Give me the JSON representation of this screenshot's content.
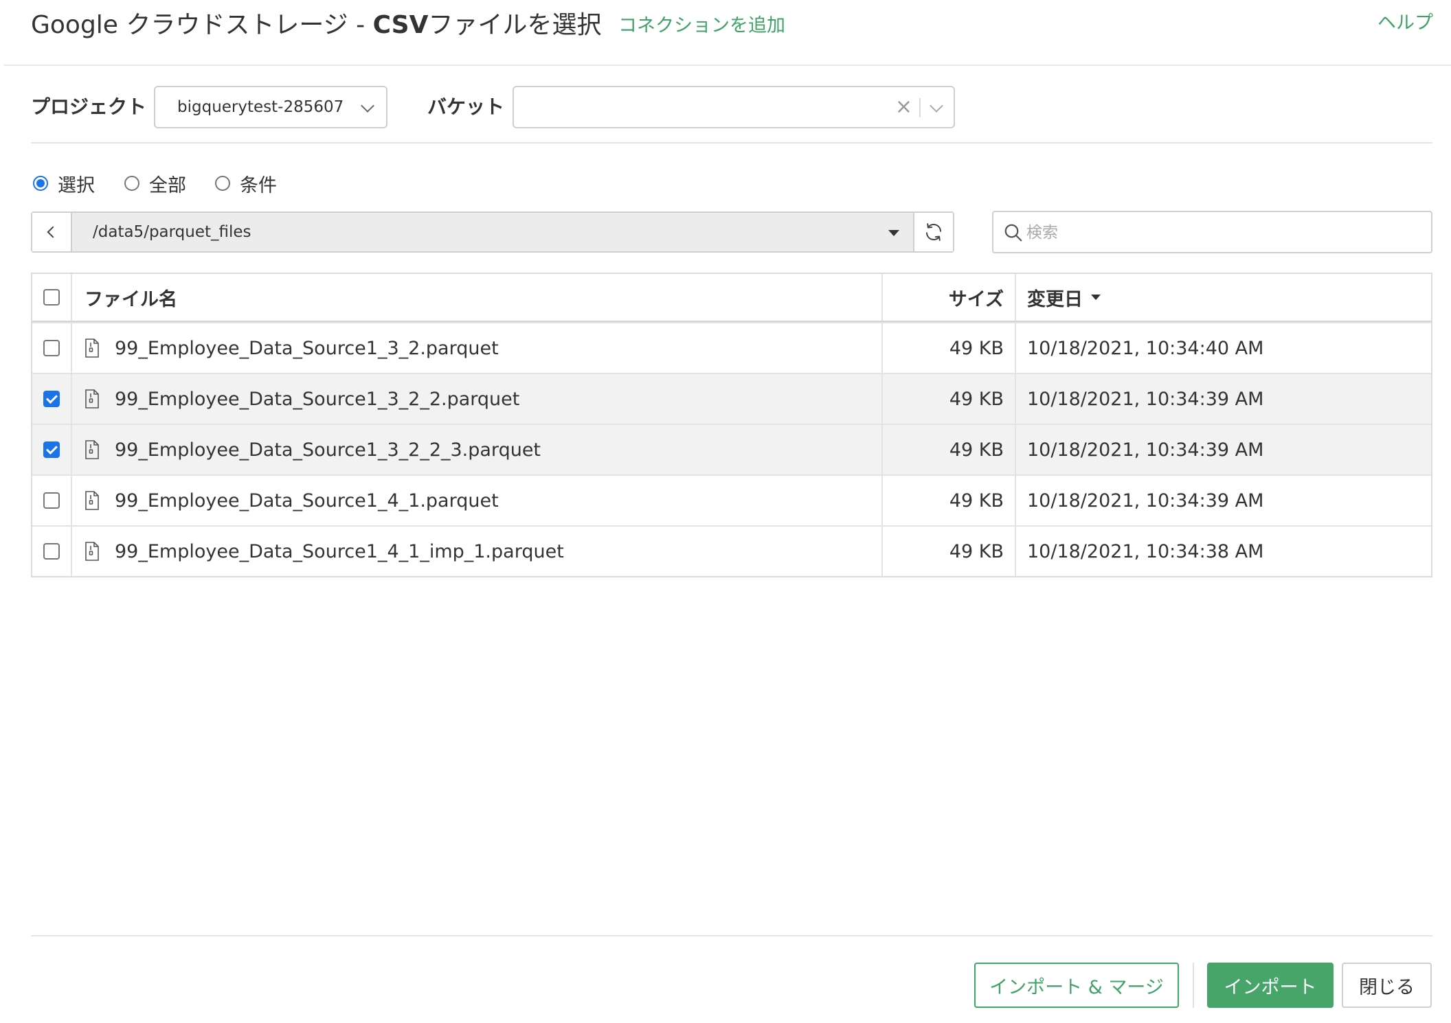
{
  "header": {
    "title_prefix": "Google クラウドストレージ - ",
    "title_bold": "CSV",
    "title_suffix": "ファイルを選択",
    "add_connection": "コネクションを追加",
    "help": "ヘルプ"
  },
  "filters": {
    "project_label": "プロジェクト",
    "project_value": "bigquerytest-285607",
    "bucket_label": "バケット",
    "bucket_value": "",
    "bucket_clear": "×"
  },
  "modes": [
    {
      "label": "選択",
      "checked": true
    },
    {
      "label": "全部",
      "checked": false
    },
    {
      "label": "条件",
      "checked": false
    }
  ],
  "path": {
    "value": "/data5/parquet_files"
  },
  "search": {
    "placeholder": "検索",
    "value": ""
  },
  "table": {
    "columns": {
      "name": "ファイル名",
      "size": "サイズ",
      "date": "変更日"
    },
    "rows": [
      {
        "name": "99_Employee_Data_Source1_3_2.parquet",
        "size": "49 KB",
        "date": "10/18/2021, 10:34:40 AM",
        "checked": false
      },
      {
        "name": "99_Employee_Data_Source1_3_2_2.parquet",
        "size": "49 KB",
        "date": "10/18/2021, 10:34:39 AM",
        "checked": true
      },
      {
        "name": "99_Employee_Data_Source1_3_2_2_3.parquet",
        "size": "49 KB",
        "date": "10/18/2021, 10:34:39 AM",
        "checked": true
      },
      {
        "name": "99_Employee_Data_Source1_4_1.parquet",
        "size": "49 KB",
        "date": "10/18/2021, 10:34:39 AM",
        "checked": false
      },
      {
        "name": "99_Employee_Data_Source1_4_1_imp_1.parquet",
        "size": "49 KB",
        "date": "10/18/2021, 10:34:38 AM",
        "checked": false
      }
    ]
  },
  "footer": {
    "import_merge": "インポート & マージ",
    "import": "インポート",
    "close": "閉じる"
  },
  "colors": {
    "accent_green": "#3fa367",
    "checkbox_blue": "#1a73e8"
  },
  "icons": {
    "back": "chevron-left-icon",
    "path_dropdown": "caret-down-icon",
    "refresh": "refresh-icon",
    "search": "search-icon",
    "file": "file-zip-icon",
    "sort": "sort-desc-icon"
  }
}
